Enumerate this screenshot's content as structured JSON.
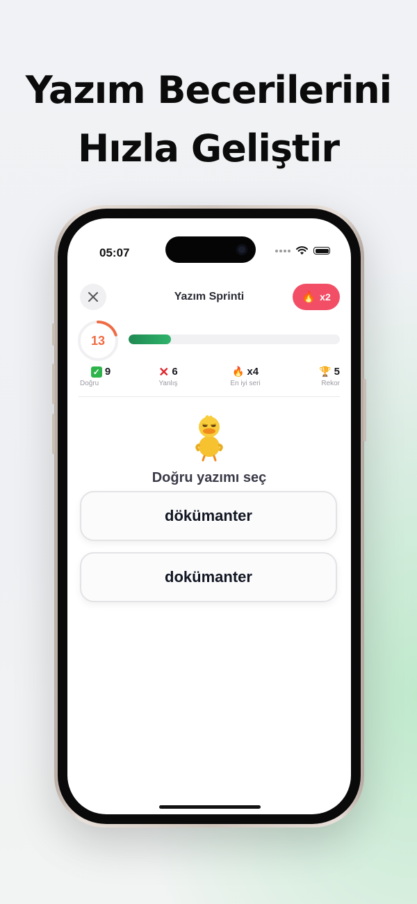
{
  "headline": {
    "line1": "Yazım Becerilerini",
    "line2": "Hızla Geliştir"
  },
  "status_bar": {
    "time": "05:07"
  },
  "header": {
    "title": "Yazım Sprinti",
    "streak_multiplier": "x2"
  },
  "timer": {
    "seconds_left": "13"
  },
  "progress": {
    "fraction": 0.2
  },
  "stats": [
    {
      "icon": "check-mark-icon",
      "value": "9",
      "label": "Doğru"
    },
    {
      "icon": "cross-mark-icon",
      "value": "6",
      "label": "Yanlış"
    },
    {
      "icon": "fire-icon",
      "value": "x4",
      "label": "En iyi seri"
    },
    {
      "icon": "trophy-icon",
      "value": "5",
      "label": "Rekor"
    }
  ],
  "question": {
    "prompt": "Doğru yazımı seç",
    "options": [
      "dökümanter",
      "dokümanter"
    ]
  },
  "colors": {
    "accent_red": "#f24f66",
    "progress_green": "#2fb36b",
    "timer_orange": "#ef6b44"
  }
}
